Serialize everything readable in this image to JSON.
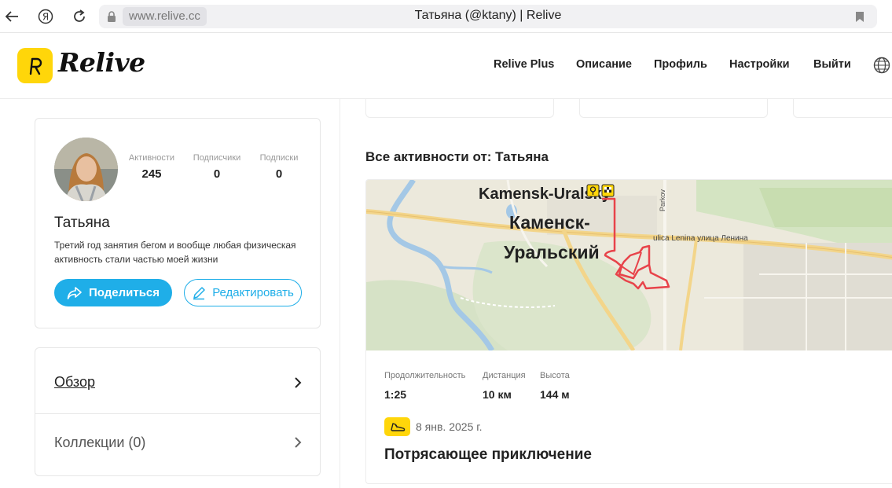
{
  "browser": {
    "url": "www.relive.cc",
    "tab_title": "Татьяна (@ktany) | Relive"
  },
  "header": {
    "logo_text": "Relive",
    "nav": [
      "Relive Plus",
      "Описание",
      "Профиль",
      "Настройки",
      "Выйти"
    ]
  },
  "profile": {
    "name": "Татьяна",
    "bio_line1": "Третий год занятия бегом и вообще любая физическая",
    "bio_line2": "активность стали частью моей жизни",
    "stats": [
      {
        "label": "Активности",
        "value": "245"
      },
      {
        "label": "Подписчики",
        "value": "0"
      },
      {
        "label": "Подписки",
        "value": "0"
      }
    ],
    "share_label": "Поделиться",
    "edit_label": "Редактировать"
  },
  "menu": {
    "overview": "Обзор",
    "collections": "Коллекции (0)"
  },
  "activities": {
    "section_title": "Все активности от: Татьяна",
    "item": {
      "map_labels": {
        "city_latin": "Kamensk-Uralsky",
        "city_ru_1": "Каменск-",
        "city_ru_2": "Уральский",
        "street": "ulica Lenina улица Ленина",
        "park": "Parkov"
      },
      "stats": [
        {
          "label": "Продолжительность",
          "value": "1:25"
        },
        {
          "label": "Дистанция",
          "value": "10 км"
        },
        {
          "label": "Высота",
          "value": "144 м"
        }
      ],
      "date": "8 янв. 2025 г.",
      "title": "Потрясающее приключение"
    }
  },
  "colors": {
    "brand_yellow": "#ffd60a",
    "accent_blue": "#1faee8",
    "route_red": "#e8434a"
  }
}
